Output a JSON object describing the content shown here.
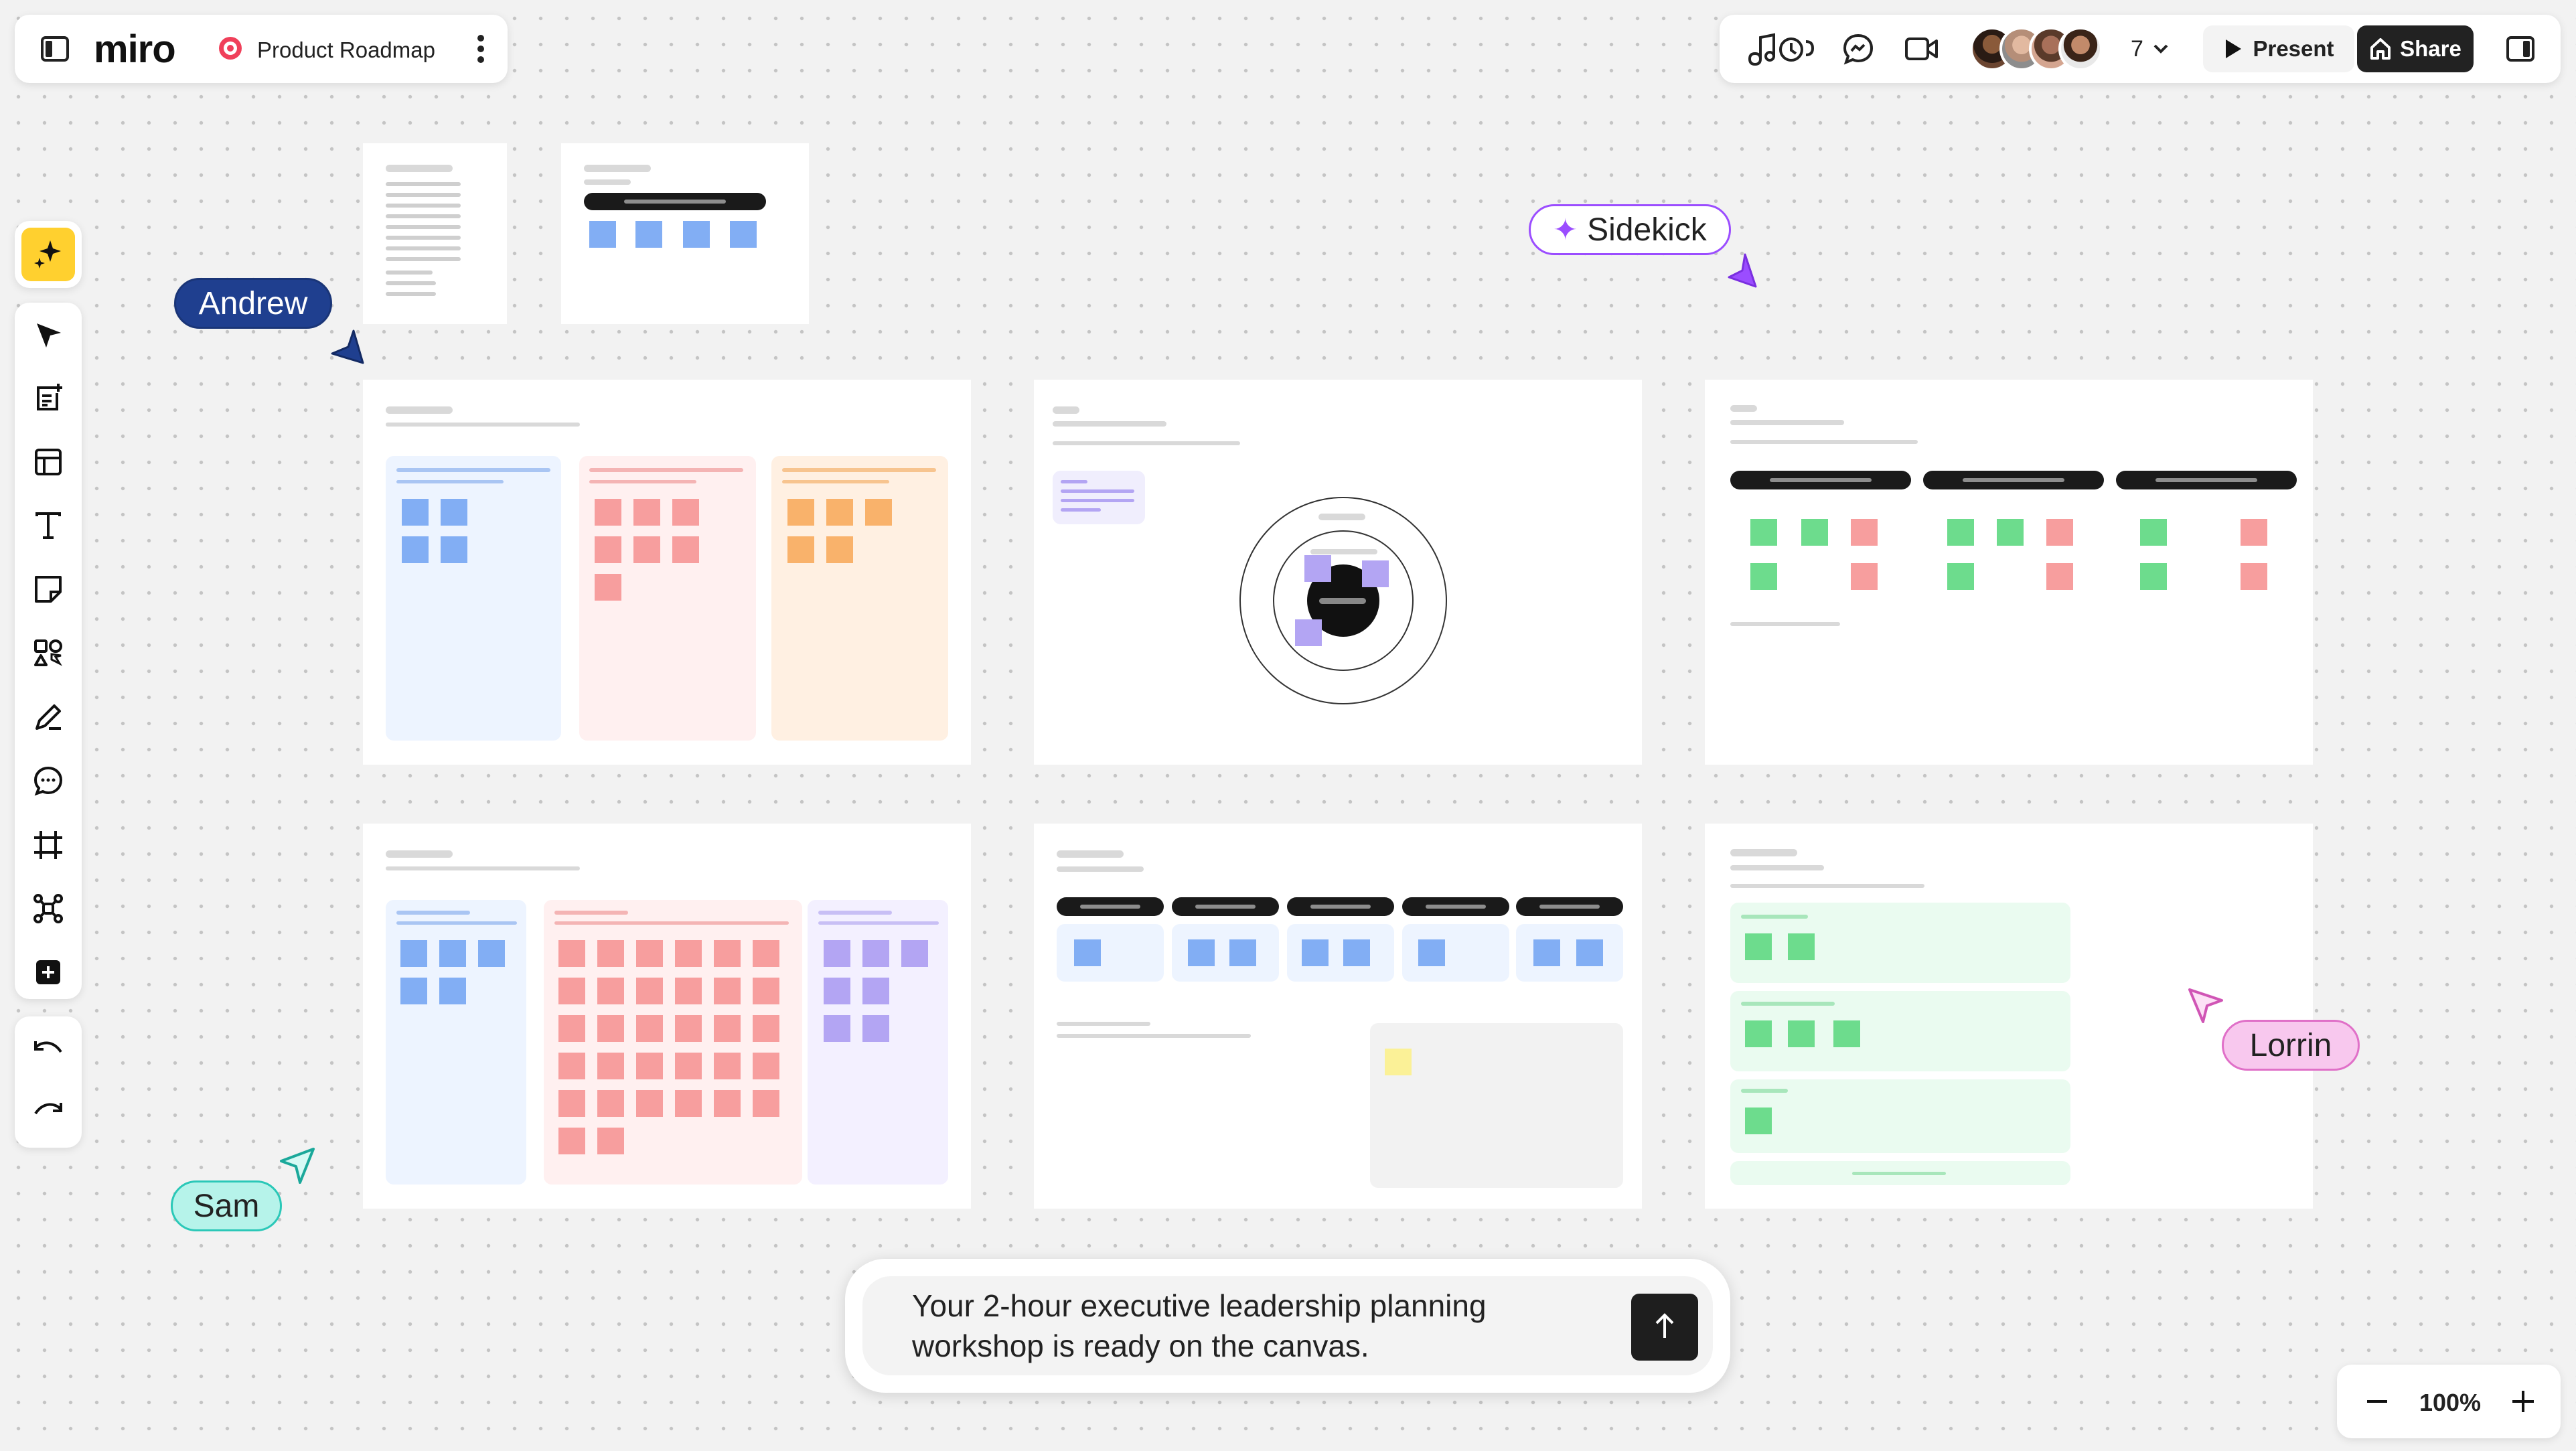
{
  "app": {
    "logo_text": "miro",
    "board_title": "Product Roadmap"
  },
  "header": {
    "collaborator_count": "7",
    "present_label": "Present",
    "share_label": "Share"
  },
  "icons": [
    "panel-toggle-icon",
    "board-icon",
    "more-vertical-icon",
    "reactions-icon",
    "chat-icon",
    "video-icon",
    "chevron-down-icon",
    "play-icon",
    "share-icon",
    "side-panel-icon",
    "sparkle-icon",
    "cursor-select-icon",
    "sticky-note-template-icon",
    "layout-icon",
    "text-icon",
    "sticky-note-icon",
    "shapes-icon",
    "pen-icon",
    "comment-icon",
    "frame-icon",
    "mind-map-icon",
    "add-icon",
    "undo-icon",
    "redo-icon",
    "send-arrow-icon",
    "zoom-out-icon",
    "zoom-in-icon"
  ],
  "cursors": {
    "andrew": "Andrew",
    "sidekick": "Sidekick",
    "sam": "Sam",
    "lorrin": "Lorrin"
  },
  "sidekick_message": "Your 2-hour executive leadership planning workshop is ready on the canvas.",
  "zoom": {
    "level": "100%"
  },
  "colors": {
    "accent_yellow": "#ffd02f",
    "andrew": "#1f3f8f",
    "sidekick": "#9b4dff",
    "sam": "#2bc8b8",
    "lorrin": "#e070c8"
  }
}
